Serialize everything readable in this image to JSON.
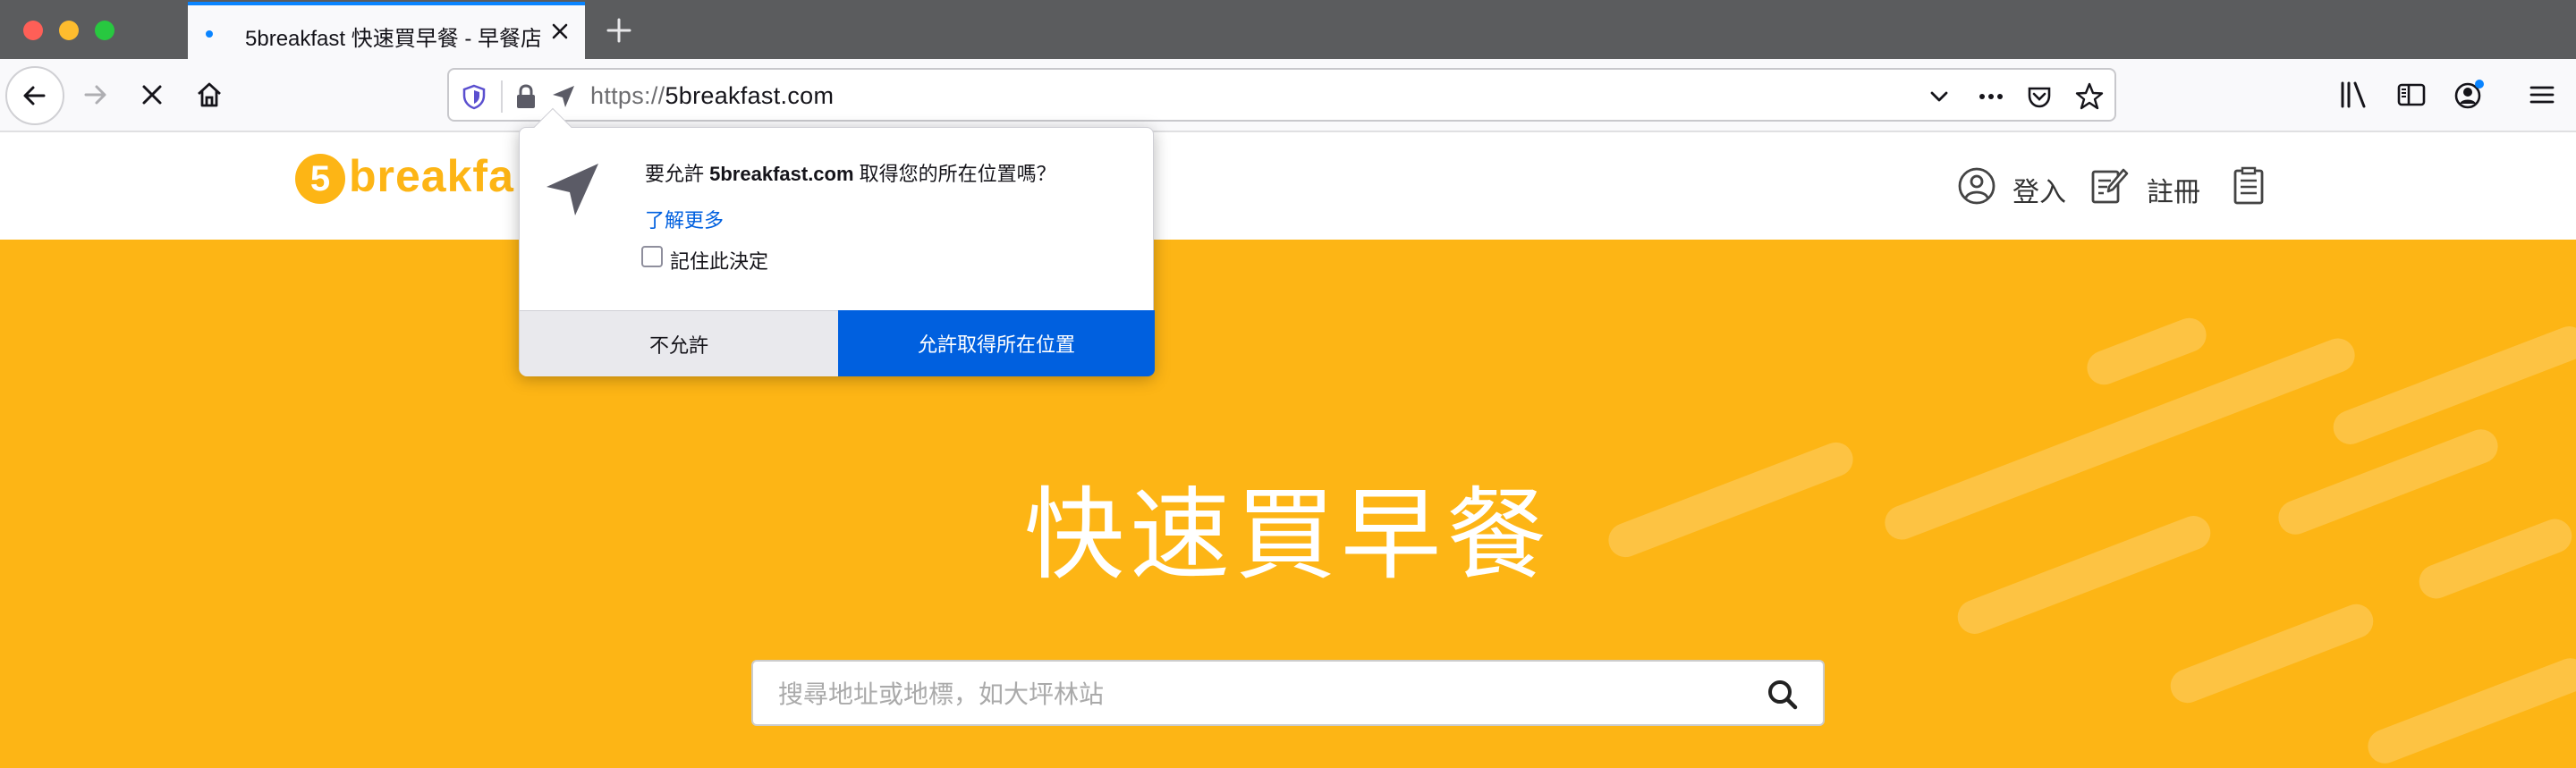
{
  "browser": {
    "tab": {
      "title": "5breakfast 快速買早餐 - 早餐店"
    },
    "url": {
      "scheme": "https://",
      "host": "5breakfast.com"
    }
  },
  "site": {
    "logo": {
      "digit": "5",
      "text": "breakfa"
    },
    "header": {
      "login_label": "登入",
      "register_label": "註冊"
    },
    "hero": {
      "title": "快速買早餐",
      "search_placeholder": "搜尋地址或地標，如大坪林站"
    }
  },
  "permission_popup": {
    "message_prefix": "要允許 ",
    "message_domain": "5breakfast.com",
    "message_suffix": " 取得您的所在位置嗎？",
    "learn_more_label": "了解更多",
    "remember_label": "記住此決定",
    "remember_checked": false,
    "deny_label": "不允許",
    "allow_label": "允許取得所在位置"
  },
  "colors": {
    "brand": "#fdb515",
    "allow_button": "#0060df",
    "tab_accent": "#0a84ff"
  }
}
